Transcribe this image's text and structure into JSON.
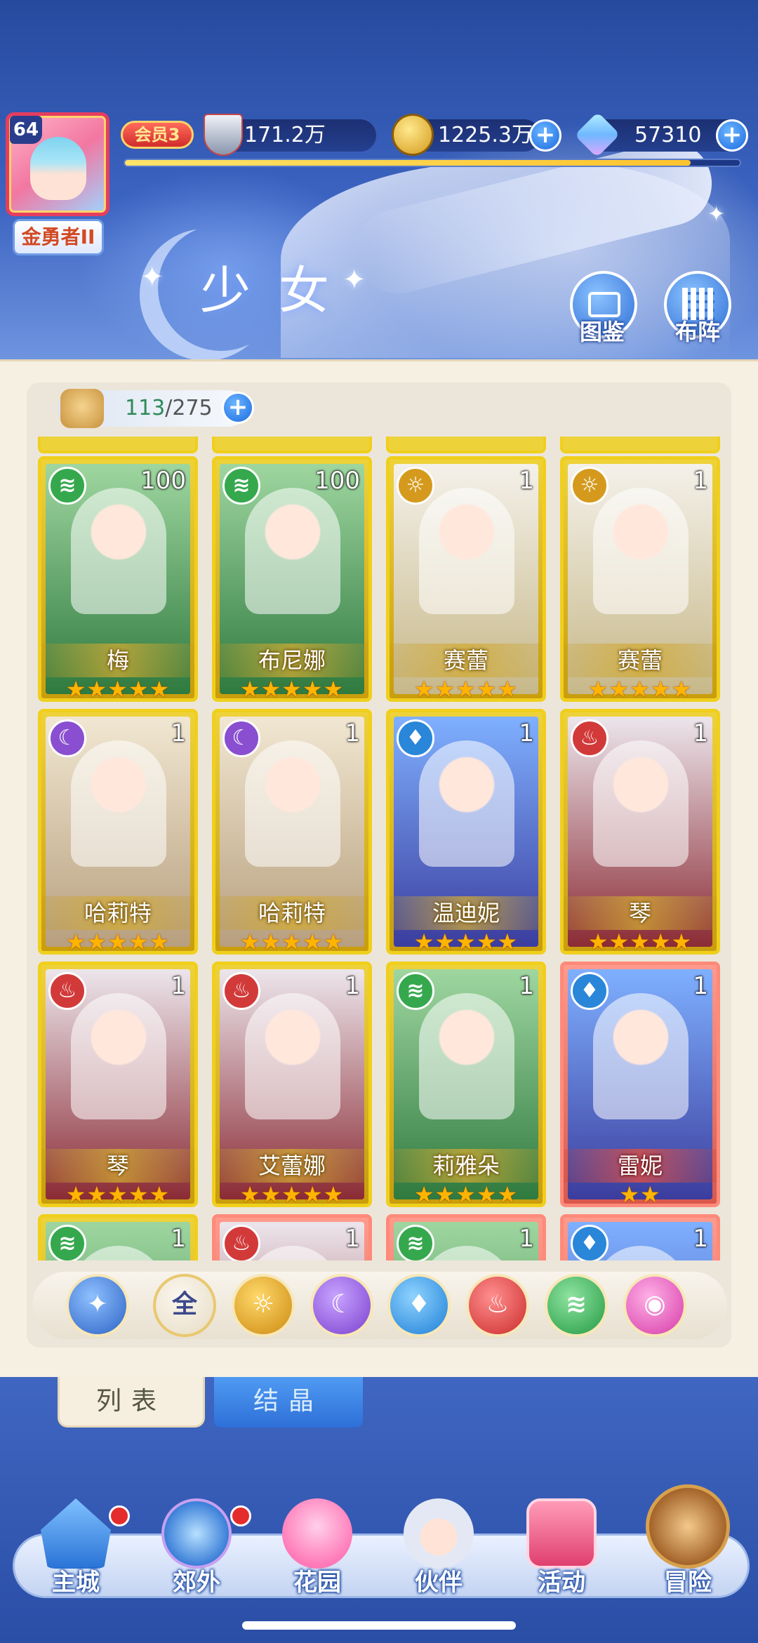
{
  "header": {
    "player_level": "64",
    "player_rank": "金勇者II",
    "vip": "会员3",
    "power": "171.2万",
    "gold": "1225.3万",
    "gems": "57310",
    "exp_fill_percent": 92,
    "section_title": "少女",
    "btn_gallery": "图鉴",
    "btn_formation": "布阵"
  },
  "inventory": {
    "used": "113",
    "total": "/275"
  },
  "cards": [
    {
      "name": "梅",
      "level": "100",
      "element": "wind",
      "stars": 5,
      "frame": "gold"
    },
    {
      "name": "布尼娜",
      "level": "100",
      "element": "wind",
      "stars": 5,
      "frame": "gold"
    },
    {
      "name": "赛蕾",
      "level": "1",
      "element": "light",
      "stars": 5,
      "frame": "gold"
    },
    {
      "name": "赛蕾",
      "level": "1",
      "element": "light",
      "stars": 5,
      "frame": "gold"
    },
    {
      "name": "哈莉特",
      "level": "1",
      "element": "dark",
      "stars": 5,
      "frame": "gold"
    },
    {
      "name": "哈莉特",
      "level": "1",
      "element": "dark",
      "stars": 5,
      "frame": "gold"
    },
    {
      "name": "温迪妮",
      "level": "1",
      "element": "water",
      "stars": 5,
      "frame": "gold"
    },
    {
      "name": "琴",
      "level": "1",
      "element": "fire",
      "stars": 5,
      "frame": "gold"
    },
    {
      "name": "琴",
      "level": "1",
      "element": "fire",
      "stars": 5,
      "frame": "gold"
    },
    {
      "name": "艾蕾娜",
      "level": "1",
      "element": "fire",
      "stars": 5,
      "frame": "gold"
    },
    {
      "name": "莉雅朵",
      "level": "1",
      "element": "wind",
      "stars": 5,
      "frame": "gold"
    },
    {
      "name": "雷妮",
      "level": "1",
      "element": "water",
      "stars": 2,
      "frame": "red"
    },
    {
      "name": "",
      "level": "1",
      "element": "wind",
      "stars": 0,
      "frame": "gold"
    },
    {
      "name": "",
      "level": "1",
      "element": "fire",
      "stars": 0,
      "frame": "red"
    },
    {
      "name": "",
      "level": "1",
      "element": "wind",
      "stars": 0,
      "frame": "red"
    },
    {
      "name": "",
      "level": "1",
      "element": "water",
      "stars": 0,
      "frame": "red"
    }
  ],
  "filters": {
    "all_label": "全",
    "items": [
      "sort",
      "all",
      "light",
      "dark",
      "water",
      "fire",
      "wind",
      "pink"
    ]
  },
  "tabs": {
    "list": "列表",
    "crystal": "结晶"
  },
  "nav": {
    "main_city": "主城",
    "outskirts": "郊外",
    "garden": "花园",
    "partner": "伙伴",
    "events": "活动",
    "adventure": "冒险"
  },
  "colors": {
    "gold_frame": "#f0cf1d",
    "red_frame": "#ff8a7a",
    "wind": "#35a84d",
    "light": "#d59a1d",
    "dark": "#8a4fd0",
    "water": "#2a86d8",
    "fire": "#d23a3a"
  }
}
